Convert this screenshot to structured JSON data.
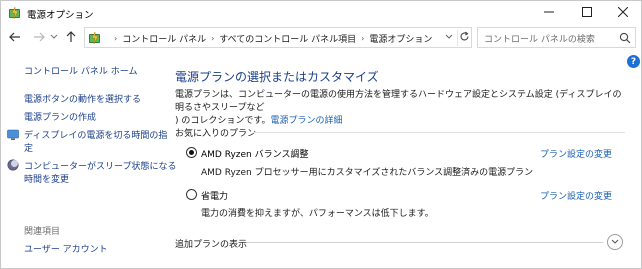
{
  "window": {
    "title": "電源オプション",
    "controls": {
      "minimize_icon": "minimize-icon",
      "maximize_icon": "maximize-icon",
      "close_icon": "close-icon"
    }
  },
  "nav": {
    "breadcrumbs": [
      "コントロール パネル",
      "すべてのコントロール パネル項目",
      "電源オプション"
    ],
    "search_placeholder": "コントロール パネルの検索"
  },
  "sidebar": {
    "home": "コントロール パネル ホーム",
    "links": [
      {
        "label": "電源ボタンの動作を選択する"
      },
      {
        "label": "電源プランの作成"
      },
      {
        "label_lines": [
          "ディスプレイの電源を切る時間の指",
          "定"
        ],
        "icon": "display-power-icon"
      },
      {
        "label_lines": [
          "コンピューターがスリープ状態になる",
          "時間を変更"
        ],
        "icon": "sleep-moon-icon"
      }
    ],
    "related_heading": "関連項目",
    "related_links": [
      {
        "label": "ユーザー アカウント"
      }
    ]
  },
  "main": {
    "title": "電源プランの選択またはカスタマイズ",
    "description_lines": [
      "電源プランは、コンピューターの電源の使用方法を管理するハードウェア設定とシステム設定 (ディスプレイの明るさやスリープなど",
      ") のコレクションです。"
    ],
    "description_link": "電源プランの詳細",
    "favorites_heading": "お気に入りのプラン",
    "plans": [
      {
        "name": "AMD Ryzen バランス調整",
        "description": "AMD Ryzen プロセッサー用にカスタマイズされたバランス調整済みの電源プラン",
        "link": "プラン設定の変更",
        "selected": true
      },
      {
        "name": "省電力",
        "description": "電力の消費を抑えますが、パフォーマンスは低下します。",
        "link": "プラン設定の変更",
        "selected": false
      }
    ],
    "more_plans": "追加プランの表示"
  },
  "colors": {
    "link": "#1a5fb4",
    "heading": "#1a3f8a",
    "help": "#1e6fd2"
  }
}
